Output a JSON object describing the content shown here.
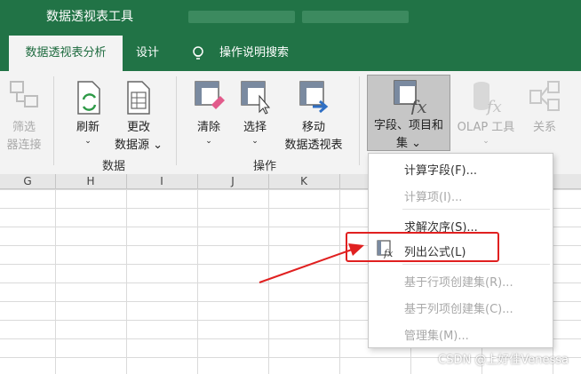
{
  "titlebar": {
    "context_tool": "数据透视表工具"
  },
  "tabs": {
    "analyze": "数据透视表分析",
    "design": "设计",
    "help": "操作说明搜索"
  },
  "ribbon": {
    "filter_connections": {
      "line1": "筛选",
      "line2": "器连接"
    },
    "refresh": {
      "line1": "刷新",
      "line2": "⌄"
    },
    "change_source": {
      "line1": "更改",
      "line2": "数据源 ⌄"
    },
    "clear": {
      "line1": "清除",
      "line2": "⌄"
    },
    "select": {
      "line1": "选择",
      "line2": "⌄"
    },
    "move": {
      "line1": "移动",
      "line2": "数据透视表"
    },
    "fields_items_sets": {
      "line1": "字段、项目和",
      "line2": "集 ⌄"
    },
    "olap_tools": {
      "line1": "OLAP 工具",
      "line2": "⌄"
    },
    "relationships": {
      "line1": "关系"
    },
    "group_data": "数据",
    "group_actions": "操作"
  },
  "columns": [
    "G",
    "H",
    "I",
    "J",
    "K"
  ],
  "menu": {
    "calculated_field": "计算字段(F)...",
    "calculated_item": "计算项(I)...",
    "solve_order": "求解次序(S)...",
    "list_formulas": "列出公式(L)",
    "create_set_rows": "基于行项创建集(R)...",
    "create_set_cols": "基于列项创建集(C)...",
    "manage_sets": "管理集(M)..."
  },
  "watermark": "CSDN @上好佳Venessa",
  "colors": {
    "excel_green": "#217346",
    "highlight_red": "#e02020"
  }
}
